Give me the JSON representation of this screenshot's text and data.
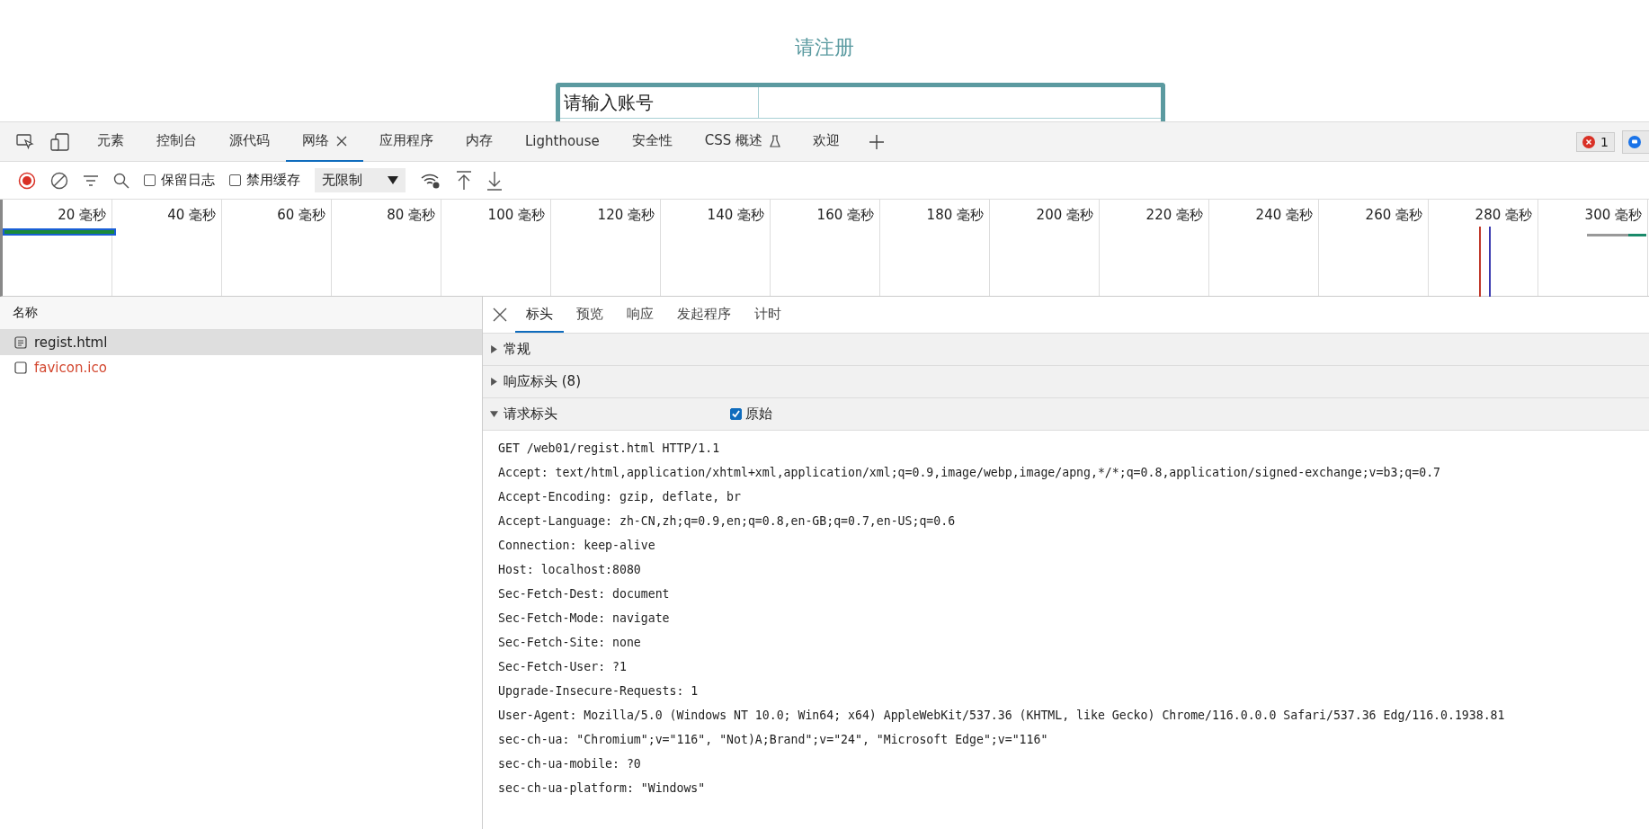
{
  "page": {
    "subtitle": "请注册",
    "form_rows": [
      {
        "label": "请输入账号"
      }
    ]
  },
  "devtools": {
    "tabs": [
      {
        "label": "元素",
        "selected": false,
        "closable": false
      },
      {
        "label": "控制台",
        "selected": false,
        "closable": false
      },
      {
        "label": "源代码",
        "selected": false,
        "closable": false
      },
      {
        "label": "网络",
        "selected": true,
        "closable": true
      },
      {
        "label": "应用程序",
        "selected": false,
        "closable": false
      },
      {
        "label": "内存",
        "selected": false,
        "closable": false
      },
      {
        "label": "Lighthouse",
        "selected": false,
        "closable": false
      },
      {
        "label": "安全性",
        "selected": false,
        "closable": false
      },
      {
        "label": "CSS 概述",
        "selected": false,
        "closable": false,
        "experimental": true
      },
      {
        "label": "欢迎",
        "selected": false,
        "closable": false
      }
    ],
    "error_count": "1"
  },
  "toolbar": {
    "recording": true,
    "options": [
      {
        "label": "保留日志",
        "checked": false
      },
      {
        "label": "禁用缓存",
        "checked": false
      }
    ],
    "throttle": "无限制"
  },
  "timeline": {
    "ticks": [
      "20 毫秒",
      "40 毫秒",
      "60 毫秒",
      "80 毫秒",
      "100 毫秒",
      "120 毫秒",
      "140 毫秒",
      "160 毫秒",
      "180 毫秒",
      "200 毫秒",
      "220 毫秒",
      "240 毫秒",
      "260 毫秒",
      "280 毫秒",
      "300 毫秒"
    ]
  },
  "requests": {
    "column": "名称",
    "rows": [
      {
        "name": "regist.html",
        "selected": true,
        "failed": false
      },
      {
        "name": "favicon.ico",
        "selected": false,
        "failed": true
      }
    ]
  },
  "details": {
    "tabs": [
      {
        "label": "标头",
        "selected": true
      },
      {
        "label": "预览",
        "selected": false
      },
      {
        "label": "响应",
        "selected": false
      },
      {
        "label": "发起程序",
        "selected": false
      },
      {
        "label": "计时",
        "selected": false
      }
    ],
    "sections": [
      {
        "title": "常规",
        "expanded": false
      },
      {
        "title": "响应标头 (8)",
        "expanded": false
      },
      {
        "title": "请求标头",
        "expanded": true,
        "raw": {
          "label": "原始",
          "checked": true
        }
      }
    ],
    "raw_headers": [
      "GET /web01/regist.html HTTP/1.1",
      "Accept: text/html,application/xhtml+xml,application/xml;q=0.9,image/webp,image/apng,*/*;q=0.8,application/signed-exchange;v=b3;q=0.7",
      "Accept-Encoding: gzip, deflate, br",
      "Accept-Language: zh-CN,zh;q=0.9,en;q=0.8,en-GB;q=0.7,en-US;q=0.6",
      "Connection: keep-alive",
      "Host: localhost:8080",
      "Sec-Fetch-Dest: document",
      "Sec-Fetch-Mode: navigate",
      "Sec-Fetch-Site: none",
      "Sec-Fetch-User: ?1",
      "Upgrade-Insecure-Requests: 1",
      "User-Agent: Mozilla/5.0 (Windows NT 10.0; Win64; x64) AppleWebKit/537.36 (KHTML, like Gecko) Chrome/116.0.0.0 Safari/537.36 Edg/116.0.1938.81",
      "sec-ch-ua: \"Chromium\";v=\"116\", \"Not)A;Brand\";v=\"24\", \"Microsoft Edge\";v=\"116\"",
      "sec-ch-ua-mobile: ?0",
      "sec-ch-ua-platform: \"Windows\""
    ]
  }
}
